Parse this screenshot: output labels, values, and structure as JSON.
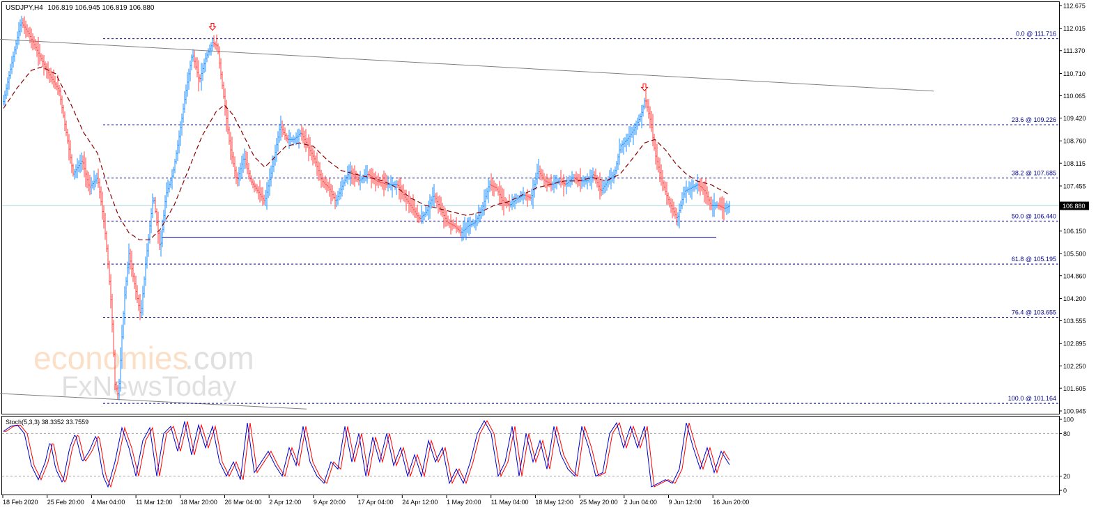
{
  "chart_data": {
    "type": "candlestick",
    "symbol_header": "USDJPY,H4",
    "ohlc_header": "106.819 106.945 106.819 106.880",
    "current_price_label": "106.880",
    "current_price": 106.88,
    "price_axis_ticks": [
      "112.675",
      "112.015",
      "111.370",
      "110.710",
      "110.065",
      "109.420",
      "108.760",
      "108.115",
      "107.455",
      "106.800",
      "106.150",
      "105.500",
      "104.860",
      "104.200",
      "103.555",
      "102.895",
      "102.250",
      "101.605",
      "100.945"
    ],
    "ylim": [
      100.945,
      112.675
    ],
    "time_axis_ticks": [
      "18 Feb 2020",
      "25 Feb 20:00",
      "4 Mar 04:00",
      "11 Mar 12:00",
      "18 Mar 20:00",
      "26 Mar 04:00",
      "2 Apr 12:00",
      "9 Apr 20:00",
      "17 Apr 04:00",
      "24 Apr 12:00",
      "1 May 20:00",
      "11 May 04:00",
      "18 May 12:00",
      "25 May 20:00",
      "2 Jun 04:00",
      "9 Jun 12:00",
      "16 Jun 20:00"
    ],
    "fib_levels": [
      {
        "label": "0.0 @ 111.716",
        "value": 111.716
      },
      {
        "label": "23.6 @ 109.226",
        "value": 109.226
      },
      {
        "label": "38.2 @ 107.685",
        "value": 107.685
      },
      {
        "label": "50.0 @ 106.440",
        "value": 106.44
      },
      {
        "label": "61.8 @ 105.195",
        "value": 105.195
      },
      {
        "label": "76.4 @ 103.655",
        "value": 103.655
      },
      {
        "label": "100.0 @ 101.164",
        "value": 101.164
      }
    ],
    "support_level": 105.97,
    "trendlines": [
      {
        "from": [
          0,
          111.7
        ],
        "to": [
          1340,
          110.2
        ]
      },
      {
        "from": [
          0,
          101.45
        ],
        "to": [
          440,
          101.0
        ]
      }
    ],
    "arrows": [
      {
        "bar": 305,
        "price": 112.0
      },
      {
        "bar": 925,
        "price": 110.25
      }
    ],
    "price_keypoints": [
      [
        5,
        109.9
      ],
      [
        20,
        111.3
      ],
      [
        30,
        112.2
      ],
      [
        40,
        111.9
      ],
      [
        55,
        111.3
      ],
      [
        70,
        110.7
      ],
      [
        85,
        110.2
      ],
      [
        95,
        109.0
      ],
      [
        105,
        107.8
      ],
      [
        118,
        108.2
      ],
      [
        128,
        107.4
      ],
      [
        140,
        107.7
      ],
      [
        150,
        106.3
      ],
      [
        155,
        105.2
      ],
      [
        160,
        103.9
      ],
      [
        165,
        101.7
      ],
      [
        170,
        101.4
      ],
      [
        178,
        104.1
      ],
      [
        185,
        105.5
      ],
      [
        195,
        104.4
      ],
      [
        202,
        103.7
      ],
      [
        210,
        105.4
      ],
      [
        220,
        107.2
      ],
      [
        230,
        105.6
      ],
      [
        238,
        107.2
      ],
      [
        248,
        107.8
      ],
      [
        258,
        109.0
      ],
      [
        266,
        110.1
      ],
      [
        276,
        111.3
      ],
      [
        286,
        110.5
      ],
      [
        296,
        111.2
      ],
      [
        305,
        111.6
      ],
      [
        312,
        111.5
      ],
      [
        320,
        110.2
      ],
      [
        330,
        108.6
      ],
      [
        340,
        107.6
      ],
      [
        350,
        108.3
      ],
      [
        360,
        107.6
      ],
      [
        370,
        107.3
      ],
      [
        380,
        107.0
      ],
      [
        392,
        108.1
      ],
      [
        402,
        109.2
      ],
      [
        412,
        108.8
      ],
      [
        422,
        108.8
      ],
      [
        432,
        109.0
      ],
      [
        442,
        108.6
      ],
      [
        452,
        108.2
      ],
      [
        462,
        107.6
      ],
      [
        472,
        107.4
      ],
      [
        482,
        107.0
      ],
      [
        492,
        107.5
      ],
      [
        502,
        107.9
      ],
      [
        515,
        107.6
      ],
      [
        528,
        107.8
      ],
      [
        540,
        107.6
      ],
      [
        555,
        107.5
      ],
      [
        570,
        107.5
      ],
      [
        582,
        107.1
      ],
      [
        592,
        106.8
      ],
      [
        602,
        106.5
      ],
      [
        612,
        106.7
      ],
      [
        622,
        107.2
      ],
      [
        632,
        106.8
      ],
      [
        642,
        106.4
      ],
      [
        652,
        106.3
      ],
      [
        662,
        106.1
      ],
      [
        672,
        106.3
      ],
      [
        682,
        106.4
      ],
      [
        692,
        106.8
      ],
      [
        702,
        107.5
      ],
      [
        712,
        107.4
      ],
      [
        722,
        107.0
      ],
      [
        732,
        106.9
      ],
      [
        742,
        107.1
      ],
      [
        752,
        107.2
      ],
      [
        762,
        107.1
      ],
      [
        772,
        107.9
      ],
      [
        782,
        107.6
      ],
      [
        792,
        107.5
      ],
      [
        802,
        107.6
      ],
      [
        812,
        107.5
      ],
      [
        822,
        107.7
      ],
      [
        832,
        107.6
      ],
      [
        842,
        107.6
      ],
      [
        852,
        107.8
      ],
      [
        862,
        107.3
      ],
      [
        872,
        107.6
      ],
      [
        882,
        107.8
      ],
      [
        890,
        108.6
      ],
      [
        900,
        108.8
      ],
      [
        910,
        109.1
      ],
      [
        920,
        109.5
      ],
      [
        926,
        110.0
      ],
      [
        934,
        109.3
      ],
      [
        940,
        108.4
      ],
      [
        950,
        107.6
      ],
      [
        960,
        107.0
      ],
      [
        972,
        106.5
      ],
      [
        982,
        107.3
      ],
      [
        992,
        107.4
      ],
      [
        1002,
        107.5
      ],
      [
        1012,
        107.3
      ],
      [
        1020,
        106.9
      ],
      [
        1030,
        106.9
      ],
      [
        1040,
        106.8
      ],
      [
        1047,
        106.88
      ]
    ],
    "moving_average": {
      "style": "dashed",
      "color": "#8b0000",
      "keypoints": [
        [
          5,
          109.7
        ],
        [
          25,
          110.3
        ],
        [
          45,
          110.8
        ],
        [
          60,
          110.9
        ],
        [
          80,
          110.7
        ],
        [
          100,
          109.9
        ],
        [
          120,
          109.0
        ],
        [
          140,
          108.4
        ],
        [
          155,
          107.4
        ],
        [
          170,
          106.6
        ],
        [
          185,
          106.1
        ],
        [
          200,
          105.9
        ],
        [
          215,
          105.9
        ],
        [
          230,
          106.2
        ],
        [
          250,
          106.9
        ],
        [
          270,
          107.9
        ],
        [
          290,
          108.9
        ],
        [
          310,
          109.6
        ],
        [
          322,
          109.8
        ],
        [
          335,
          109.5
        ],
        [
          350,
          108.9
        ],
        [
          365,
          108.3
        ],
        [
          380,
          108.0
        ],
        [
          395,
          108.3
        ],
        [
          410,
          108.6
        ],
        [
          430,
          108.7
        ],
        [
          450,
          108.6
        ],
        [
          470,
          108.2
        ],
        [
          490,
          107.9
        ],
        [
          510,
          107.8
        ],
        [
          530,
          107.7
        ],
        [
          550,
          107.6
        ],
        [
          570,
          107.4
        ],
        [
          590,
          107.1
        ],
        [
          610,
          106.9
        ],
        [
          630,
          106.8
        ],
        [
          650,
          106.7
        ],
        [
          670,
          106.6
        ],
        [
          690,
          106.7
        ],
        [
          710,
          106.9
        ],
        [
          730,
          107.0
        ],
        [
          750,
          107.2
        ],
        [
          770,
          107.4
        ],
        [
          790,
          107.5
        ],
        [
          810,
          107.6
        ],
        [
          830,
          107.6
        ],
        [
          850,
          107.7
        ],
        [
          870,
          107.6
        ],
        [
          890,
          107.8
        ],
        [
          910,
          108.3
        ],
        [
          925,
          108.7
        ],
        [
          940,
          108.8
        ],
        [
          955,
          108.5
        ],
        [
          970,
          108.1
        ],
        [
          985,
          107.8
        ],
        [
          1000,
          107.6
        ],
        [
          1020,
          107.5
        ],
        [
          1047,
          107.2
        ]
      ]
    },
    "oscillator": {
      "label": "Stoch(5,3,3) 38.3352 33.7559",
      "k_value": 38.3352,
      "d_value": 33.7559,
      "ylim": [
        0,
        100
      ],
      "axis_ticks": [
        "100",
        "80",
        "20",
        "0"
      ],
      "levels": [
        80,
        20
      ],
      "k_color": "#0000cd",
      "d_color": "#ff0000",
      "keypoints": [
        [
          5,
          83
        ],
        [
          15,
          90
        ],
        [
          25,
          92
        ],
        [
          35,
          80
        ],
        [
          45,
          35
        ],
        [
          55,
          15
        ],
        [
          65,
          40
        ],
        [
          72,
          70
        ],
        [
          80,
          30
        ],
        [
          90,
          10
        ],
        [
          100,
          60
        ],
        [
          108,
          80
        ],
        [
          118,
          40
        ],
        [
          128,
          55
        ],
        [
          138,
          78
        ],
        [
          148,
          20
        ],
        [
          155,
          5
        ],
        [
          165,
          40
        ],
        [
          175,
          88
        ],
        [
          185,
          60
        ],
        [
          195,
          20
        ],
        [
          205,
          70
        ],
        [
          215,
          88
        ],
        [
          225,
          20
        ],
        [
          235,
          80
        ],
        [
          245,
          90
        ],
        [
          255,
          55
        ],
        [
          265,
          97
        ],
        [
          275,
          50
        ],
        [
          285,
          92
        ],
        [
          295,
          60
        ],
        [
          305,
          90
        ],
        [
          315,
          40
        ],
        [
          325,
          20
        ],
        [
          335,
          40
        ],
        [
          345,
          15
        ],
        [
          355,
          95
        ],
        [
          365,
          25
        ],
        [
          375,
          40
        ],
        [
          385,
          55
        ],
        [
          395,
          35
        ],
        [
          405,
          20
        ],
        [
          415,
          60
        ],
        [
          425,
          35
        ],
        [
          435,
          90
        ],
        [
          445,
          40
        ],
        [
          455,
          20
        ],
        [
          465,
          10
        ],
        [
          475,
          40
        ],
        [
          485,
          30
        ],
        [
          495,
          90
        ],
        [
          505,
          40
        ],
        [
          515,
          80
        ],
        [
          525,
          20
        ],
        [
          535,
          75
        ],
        [
          545,
          40
        ],
        [
          555,
          80
        ],
        [
          565,
          35
        ],
        [
          575,
          60
        ],
        [
          585,
          20
        ],
        [
          595,
          50
        ],
        [
          605,
          20
        ],
        [
          615,
          70
        ],
        [
          625,
          40
        ],
        [
          635,
          60
        ],
        [
          645,
          10
        ],
        [
          655,
          30
        ],
        [
          665,
          10
        ],
        [
          675,
          40
        ],
        [
          685,
          80
        ],
        [
          695,
          98
        ],
        [
          705,
          80
        ],
        [
          715,
          20
        ],
        [
          725,
          40
        ],
        [
          735,
          90
        ],
        [
          745,
          20
        ],
        [
          755,
          80
        ],
        [
          765,
          40
        ],
        [
          775,
          70
        ],
        [
          785,
          30
        ],
        [
          795,
          90
        ],
        [
          805,
          50
        ],
        [
          815,
          30
        ],
        [
          825,
          20
        ],
        [
          835,
          90
        ],
        [
          845,
          60
        ],
        [
          855,
          20
        ],
        [
          865,
          25
        ],
        [
          875,
          80
        ],
        [
          885,
          95
        ],
        [
          895,
          60
        ],
        [
          905,
          90
        ],
        [
          915,
          60
        ],
        [
          925,
          90
        ],
        [
          935,
          5
        ],
        [
          945,
          10
        ],
        [
          955,
          15
        ],
        [
          965,
          10
        ],
        [
          975,
          30
        ],
        [
          985,
          95
        ],
        [
          995,
          60
        ],
        [
          1005,
          30
        ],
        [
          1015,
          60
        ],
        [
          1025,
          25
        ],
        [
          1035,
          55
        ],
        [
          1047,
          36
        ]
      ]
    },
    "watermark": {
      "line1": "economies.com",
      "line2": "FxNewsToday"
    },
    "colors": {
      "bull": "#1e90ff",
      "bear": "#ff4040",
      "fib": "#00008b",
      "support": "#00008b",
      "trendline": "#808080",
      "current_price_line": "#add8e6",
      "arrow": "#ff0000"
    }
  }
}
